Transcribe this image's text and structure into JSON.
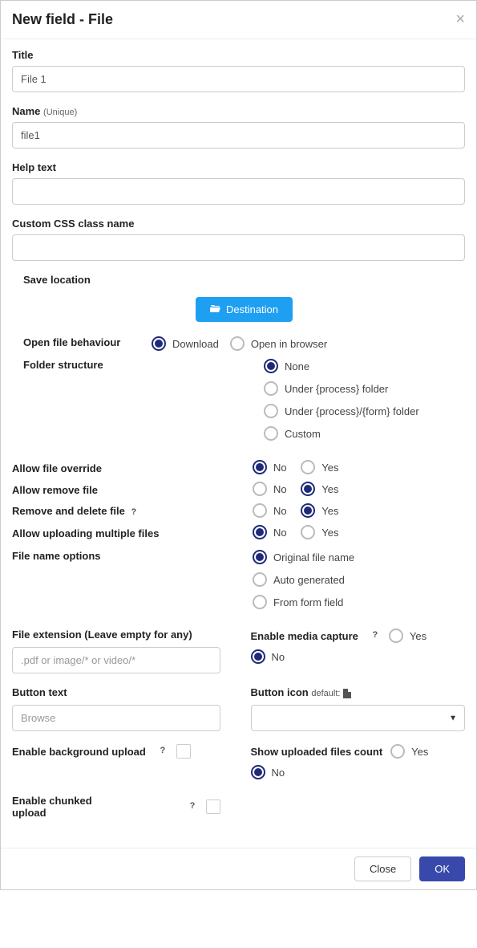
{
  "header": {
    "title": "New field - File"
  },
  "fields": {
    "title": {
      "label": "Title",
      "value": "File 1"
    },
    "name": {
      "label": "Name",
      "hint": "(Unique)",
      "value": "file1"
    },
    "helpText": {
      "label": "Help text",
      "value": ""
    },
    "cssClass": {
      "label": "Custom CSS class name",
      "value": ""
    }
  },
  "saveLocation": {
    "label": "Save location",
    "button": "Destination"
  },
  "openBehaviour": {
    "label": "Open file behaviour",
    "options": {
      "download": "Download",
      "browser": "Open in browser"
    },
    "selected": "download"
  },
  "folderStructure": {
    "label": "Folder structure",
    "options": {
      "none": "None",
      "process": "Under {process} folder",
      "processForm": "Under {process}/{form} folder",
      "custom": "Custom"
    },
    "selected": "none"
  },
  "yesNo": {
    "yes": "Yes",
    "no": "No"
  },
  "allowOverride": {
    "label": "Allow file override",
    "selected": "no"
  },
  "allowRemove": {
    "label": "Allow remove file",
    "selected": "yes"
  },
  "removeDelete": {
    "label": "Remove and delete file",
    "selected": "yes"
  },
  "allowMultiple": {
    "label": "Allow uploading multiple files",
    "selected": "no"
  },
  "fileNameOptions": {
    "label": "File name options",
    "options": {
      "original": "Original file name",
      "auto": "Auto generated",
      "field": "From form field"
    },
    "selected": "original"
  },
  "fileExtension": {
    "label": "File extension (Leave empty for any)",
    "placeholder": ".pdf or image/* or video/*",
    "value": ""
  },
  "mediaCapture": {
    "label": "Enable media capture",
    "selected": "no"
  },
  "buttonText": {
    "label": "Button text",
    "placeholder": "Browse",
    "value": ""
  },
  "buttonIcon": {
    "label": "Button icon",
    "defaultText": "default:"
  },
  "bgUpload": {
    "label": "Enable background upload",
    "checked": false
  },
  "showCount": {
    "label": "Show uploaded files count",
    "selected": "no"
  },
  "chunked": {
    "label": "Enable chunked upload",
    "checked": false
  },
  "footer": {
    "close": "Close",
    "ok": "OK"
  }
}
